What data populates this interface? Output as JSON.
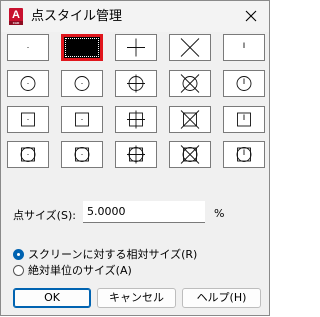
{
  "window": {
    "title": "点スタイル管理",
    "app_icon_letter": "A",
    "app_icon_sub": "CAD"
  },
  "point_styles": {
    "rows": [
      [
        "dot",
        "empty",
        "plus",
        "cross",
        "tick"
      ],
      [
        "circle",
        "circle",
        "circle-plus",
        "circle-cross",
        "circle-tick"
      ],
      [
        "square",
        "square",
        "square-plus",
        "square-cross",
        "square-tick"
      ],
      [
        "circle-square",
        "circle-square",
        "circle-square-plus",
        "circle-square-cross",
        "circle-square-tick"
      ]
    ],
    "selected_index": 1,
    "selected_border_color": "#e0161d"
  },
  "size": {
    "label": "点サイズ(S):",
    "value": "5.0000",
    "unit": "%"
  },
  "size_mode": {
    "options": [
      {
        "label": "スクリーンに対する相対サイズ(R)",
        "selected": true
      },
      {
        "label": "絶対単位のサイズ(A)",
        "selected": false
      }
    ]
  },
  "buttons": {
    "ok": "OK",
    "cancel": "キャンセル",
    "help": "ヘルプ(H)"
  },
  "colors": {
    "accent": "#0063b1",
    "app_icon": "#c8102e"
  }
}
